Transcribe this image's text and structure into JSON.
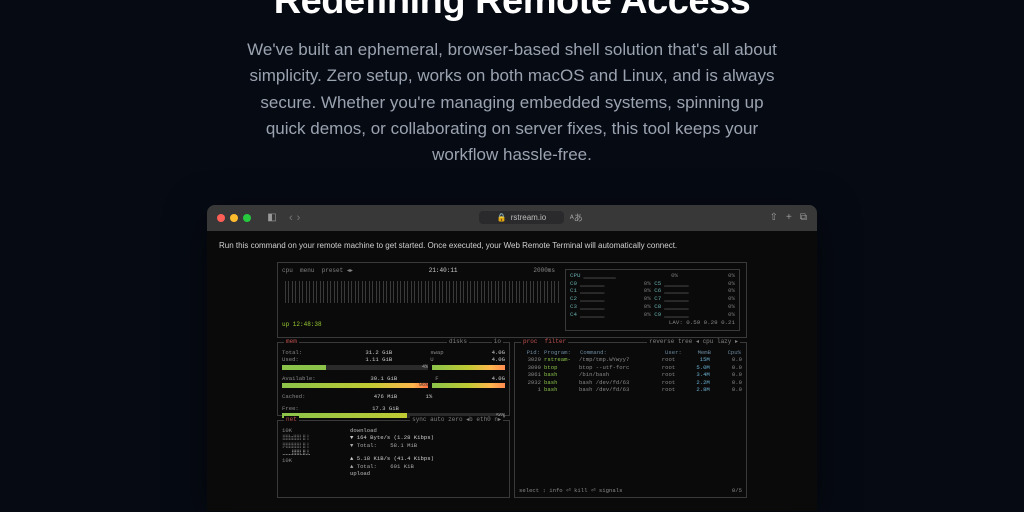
{
  "hero": {
    "title": "Redefining Remote Access",
    "description": "We've built an ephemeral, browser-based shell solution that's all about simplicity. Zero setup, works on both macOS and Linux, and is always secure. Whether you're managing embedded systems, spinning up quick demos, or collaborating on server fixes, this tool keeps your workflow hassle-free."
  },
  "browser": {
    "url": "rstream.io",
    "instruction": "Run this command on your remote machine to get started. Once executed, your Web Remote Terminal will automatically connect."
  },
  "btop": {
    "cpu_panel_title": "cpu",
    "menu_label": "menu",
    "preset_label": "preset",
    "clock": "21:40:11",
    "interval": "2000ms",
    "uptime": "up 12:48:38",
    "cpu_cores": [
      {
        "label": "CPU",
        "pct": "0%",
        "label2": "",
        "pct2": "0%"
      },
      {
        "label": "C0",
        "pct": "0%",
        "label2": "C5",
        "pct2": "0%"
      },
      {
        "label": "C1",
        "pct": "0%",
        "label2": "C6",
        "pct2": "0%"
      },
      {
        "label": "C2",
        "pct": "0%",
        "label2": "C7",
        "pct2": "0%"
      },
      {
        "label": "C3",
        "pct": "0%",
        "label2": "C8",
        "pct2": "0%"
      },
      {
        "label": "C4",
        "pct": "0%",
        "label2": "C9",
        "pct2": "0%"
      }
    ],
    "lav": "LAV: 0.59 0.29 0.21",
    "mem": {
      "title": "mem",
      "disks_label": "disks",
      "io_label": "io",
      "total_label": "Total:",
      "total": "31.2 GiB",
      "swap_label": "swap",
      "swap_total": "4.0G",
      "used_label": "Used:",
      "used": "1.11 GiB",
      "used_pct": "4%",
      "used_label2": "U",
      "swap_used": "4.0G",
      "free_label2": "F",
      "swap_free": "4.0G",
      "avail_label": "Available:",
      "avail": "30.1 GiB",
      "avail_pct": "96%",
      "cached_label": "Cached:",
      "cached": "476 MiB",
      "cached_pct": "1%",
      "free_label": "Free:",
      "free": "17.3 GiB",
      "free_pct": "56%"
    },
    "proc": {
      "title": "proc",
      "filter_label": "filter",
      "reverse_label": "reverse",
      "tree_label": "tree",
      "cpu_lazy": "cpu lazy",
      "hdr_pid": "Pid:",
      "hdr_prog": "Program:",
      "hdr_cmd": "Command:",
      "hdr_user": "User:",
      "hdr_memb": "MemB",
      "hdr_cpu": "Cpu%",
      "rows": [
        {
          "pid": "3029",
          "prog": "rstream-",
          "cmd": "/tmp/tmp.WYwyy7",
          "user": "root",
          "mem": "15M",
          "cpu": "0.0"
        },
        {
          "pid": "3090",
          "prog": "btop",
          "cmd": "btop --utf-forc",
          "user": "root",
          "mem": "5.0M",
          "cpu": "0.0"
        },
        {
          "pid": "3061",
          "prog": "bash",
          "cmd": "/bin/bash",
          "user": "root",
          "mem": "3.4M",
          "cpu": "0.0"
        },
        {
          "pid": "2932",
          "prog": "bash",
          "cmd": "bash /dev/fd/63",
          "user": "root",
          "mem": "2.2M",
          "cpu": "0.0"
        },
        {
          "pid": "1",
          "prog": "bash",
          "cmd": "bash /dev/fd/63",
          "user": "root",
          "mem": "2.8M",
          "cpu": "0.0"
        }
      ],
      "footer_select": "select",
      "footer_info": "info",
      "footer_kill": "kill",
      "footer_signals": "signals",
      "footer_count": "0/5"
    },
    "net": {
      "title": "net",
      "sync_label": "sync",
      "auto_label": "auto",
      "zero_label": "zero",
      "iface": "eth0",
      "axis1": "10K",
      "axis2": "10K",
      "dl_label": "download",
      "dl_speed": "▼ 164 Byte/s (1.28 Kibps)",
      "dl_total_label": "▼ Total:",
      "dl_total": "58.1 MiB",
      "ul_speed": "▲ 5.18 KiB/s (41.4 Kibps)",
      "ul_total_label": "▲ Total:",
      "ul_total": "601 KiB",
      "ul_label": "upload"
    }
  }
}
